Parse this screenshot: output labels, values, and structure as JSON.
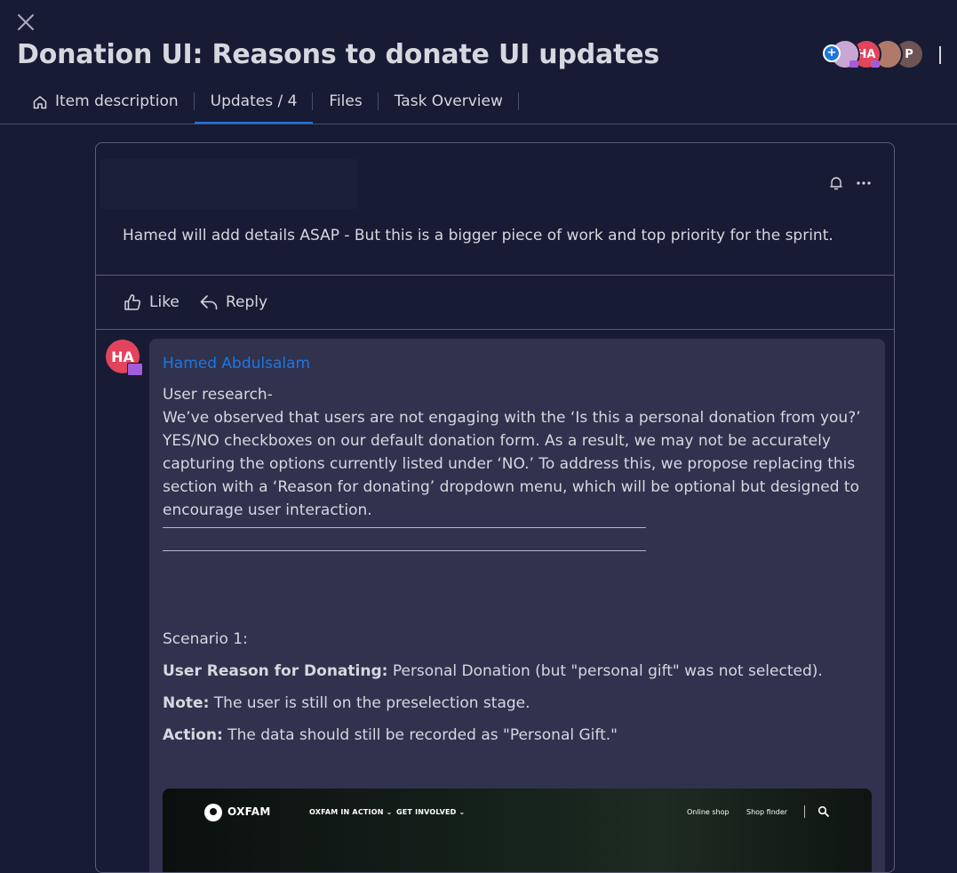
{
  "header": {
    "title": "Donation UI: Reasons to donate UI updates",
    "close_label": "close",
    "members": [
      {
        "initials": "",
        "color": "#c9a7d4"
      },
      {
        "initials": "HA",
        "color": "#e2445c"
      },
      {
        "initials": "",
        "color": "#b07a6b"
      },
      {
        "initials": "P",
        "color": "#7a5a5a"
      }
    ]
  },
  "tabs": [
    {
      "label": "Item description",
      "icon": "home-icon"
    },
    {
      "label": "Updates / 4",
      "active": true
    },
    {
      "label": "Files"
    },
    {
      "label": "Task Overview"
    }
  ],
  "update": {
    "text": "Hamed will add details ASAP - But this is a bigger piece of work and top priority for the sprint.",
    "like_label": "Like",
    "reply_label": "Reply"
  },
  "reply": {
    "avatar_initials": "HA",
    "author": "Hamed Abdulsalam",
    "heading": "User research-",
    "body": "We’ve observed that users are not engaging with the ‘Is this a personal donation from you?’ YES/NO checkboxes on our default donation form. As a result, we may not be accurately capturing the options currently listed under ‘NO.’ To address this, we propose replacing this section with a ‘Reason for donating’ dropdown menu, which will be optional but designed to encourage user interaction.",
    "scenario_title": "Scenario 1:",
    "reason_label": "User Reason for Donating:",
    "reason_value": " Personal Donation (but \"personal gift\" was not selected).",
    "note_label": "Note:",
    "note_value": " The user is still on the preselection stage.",
    "action_label": "Action:",
    "action_value": " The data should still be recorded as \"Personal Gift.\""
  },
  "embed": {
    "brand": "OXFAM",
    "nav": [
      "OXFAM IN ACTION",
      "GET INVOLVED"
    ],
    "right_links": [
      "Online shop",
      "Shop finder"
    ]
  }
}
